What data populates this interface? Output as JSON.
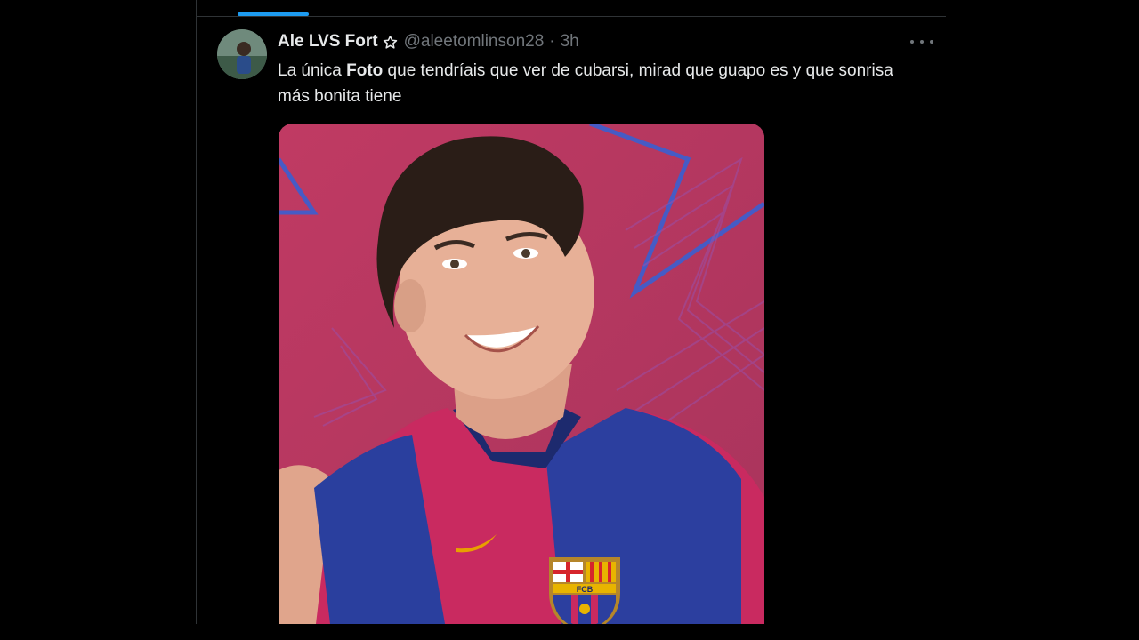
{
  "tweet": {
    "display_name": "Ale LVS Fort",
    "handle": "@aleetomlinson28",
    "separator": "·",
    "time": "3h",
    "text_before": "La única ",
    "text_bold": "Foto",
    "text_after": " que tendríais que ver de cubarsi, mirad que guapo es y que sonrisa más bonita tiene",
    "media": {
      "crest_letters": "FCB"
    }
  },
  "colors": {
    "background": "#000000",
    "accent": "#1d9bf0",
    "text_primary": "#e7e9ea",
    "text_secondary": "#71767b",
    "divider": "#2f3336"
  },
  "icons": {
    "verified_badge": "star-outline-icon",
    "more": "more-horizontal-icon"
  }
}
